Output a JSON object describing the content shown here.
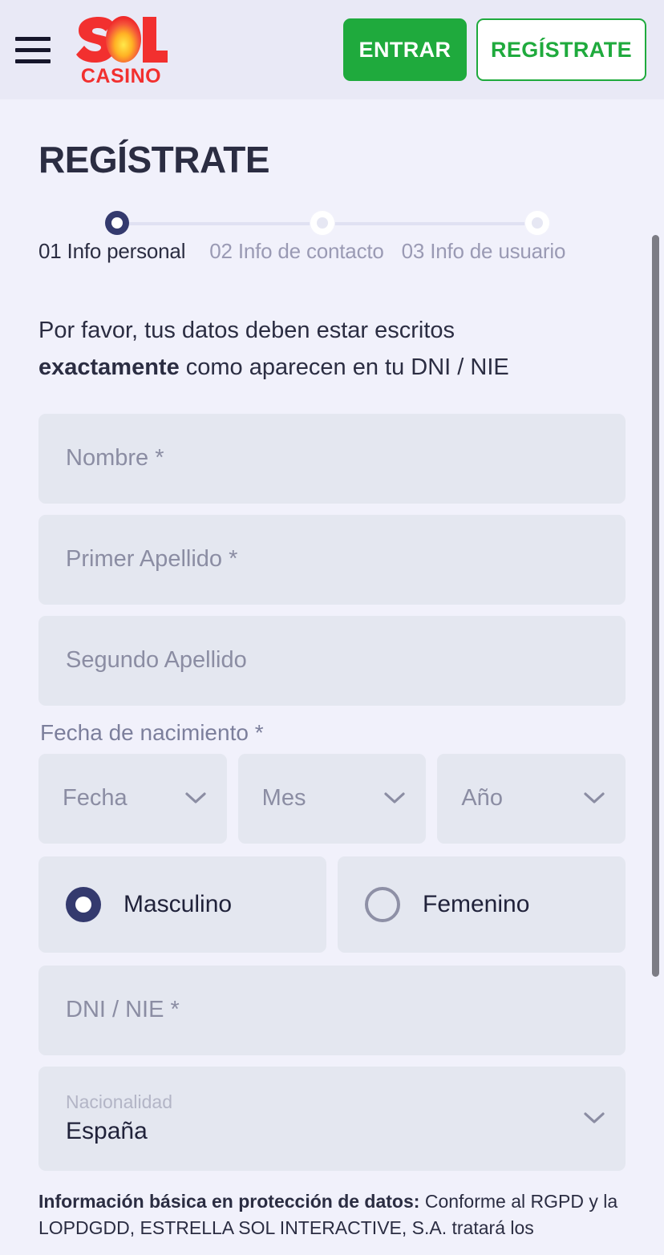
{
  "header": {
    "menu_icon": "hamburger-menu-icon",
    "logo": {
      "line1": "SOL",
      "line2": "CASINO"
    },
    "login_label": "ENTRAR",
    "register_label": "REGÍSTRATE"
  },
  "page": {
    "title": "REGÍSTRATE"
  },
  "stepper": {
    "steps": [
      {
        "num": "01",
        "label": "01 Info personal",
        "state": "active"
      },
      {
        "num": "02",
        "label": "02 Info de contacto",
        "state": "idle"
      },
      {
        "num": "03",
        "label": "03 Info de usuario",
        "state": "idle"
      }
    ]
  },
  "intro": {
    "line1": "Por favor, tus datos deben estar escritos",
    "bold": "exactamente",
    "line2_rest": " como aparecen en tu DNI / NIE"
  },
  "form": {
    "nombre_placeholder": "Nombre *",
    "primer_apellido_placeholder": "Primer Apellido *",
    "segundo_apellido_placeholder": "Segundo Apellido",
    "birth_label": "Fecha de nacimiento *",
    "day_placeholder": "Fecha",
    "month_placeholder": "Mes",
    "year_placeholder": "Año",
    "gender_male": "Masculino",
    "gender_female": "Femenino",
    "gender_selected": "Masculino",
    "dni_placeholder": "DNI / NIE *",
    "nationality_caption": "Nacionalidad",
    "nationality_value": "España"
  },
  "legal": {
    "bold": "Información básica en protección de datos:",
    "rest": " Conforme al RGPD y la LOPDGDD, ESTRELLA SOL INTERACTIVE, S.A. tratará los"
  },
  "colors": {
    "background": "#f1f1fb",
    "header_background": "#e9e9f6",
    "field_background": "#e4e7f0",
    "accent_green": "#1faa3d",
    "accent_navy": "#343a6e",
    "logo_red": "#f2302f",
    "text_dark": "#2b2d42",
    "text_muted": "#8b8da3",
    "scrollbar": "#7d7d85"
  }
}
